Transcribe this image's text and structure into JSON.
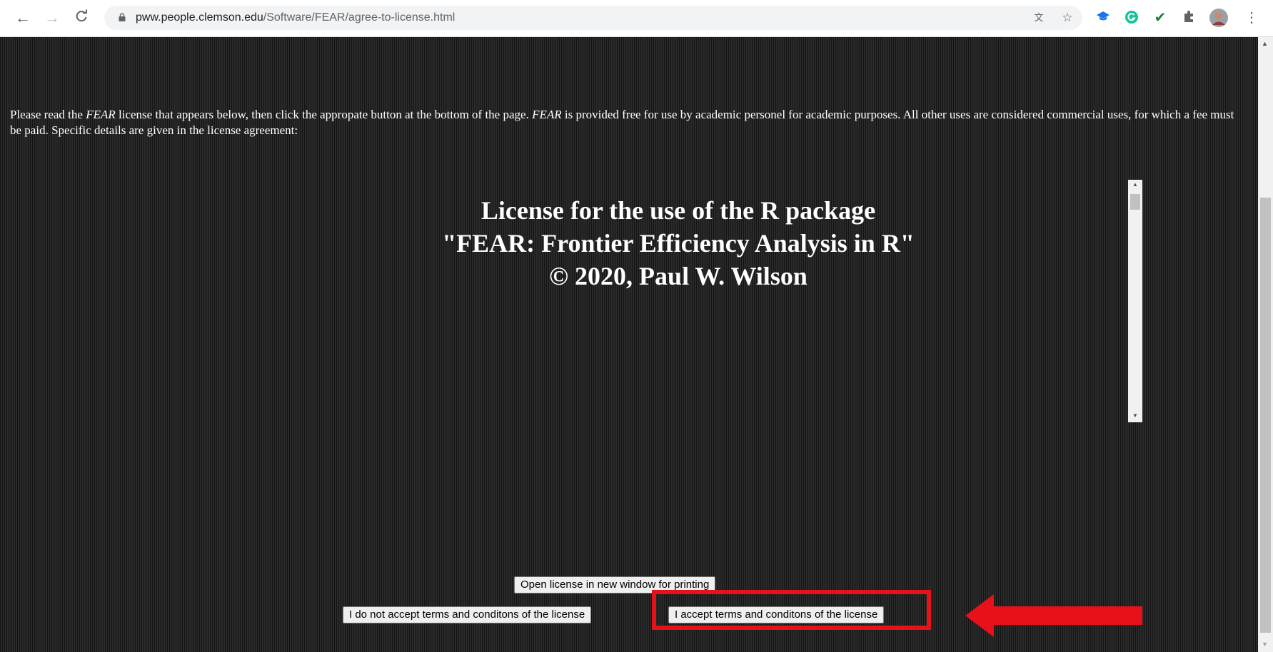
{
  "browser": {
    "url_host": "pww.people.clemson.edu",
    "url_path": "/Software/FEAR/agree-to-license.html",
    "icons": [
      "back-icon",
      "forward-icon",
      "reload-icon",
      "lock-icon",
      "translate-icon",
      "star-icon",
      "graduation-cap-icon",
      "grammarly-icon",
      "checkmark-icon",
      "extensions-icon",
      "profile-avatar",
      "kebab-menu-icon"
    ]
  },
  "intro": {
    "before": "Please read the ",
    "em1": "FEAR",
    "middle": " license that appears below, then click the appropate button at the bottom of the page. ",
    "em2": "FEAR",
    "after": " is provided free for use by academic personel for academic purposes. All other uses are considered commercial uses, for which a fee must be paid. Specific details are given in the license agreement:"
  },
  "license": {
    "line1": "License for the use of the R package",
    "line2": "\"FEAR: Frontier Efficiency Analysis in R\"",
    "line3": "© 2020, Paul W. Wilson"
  },
  "buttons": {
    "print": "Open license in new window for printing",
    "decline": "I do not accept terms and conditons of the license",
    "accept": "I accept terms and conditons of the license"
  },
  "annotation_color": "#e8111b"
}
